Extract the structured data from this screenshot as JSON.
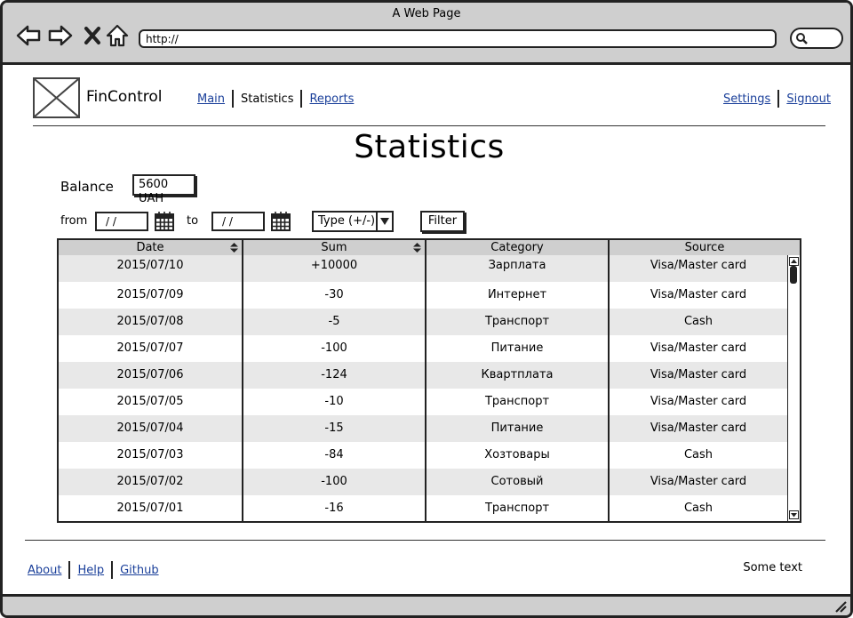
{
  "window": {
    "title": "A Web Page",
    "url": "http://"
  },
  "header": {
    "brand": "FinControl",
    "nav": [
      {
        "label": "Main",
        "link": true
      },
      {
        "label": "Statistics",
        "link": false
      },
      {
        "label": "Reports",
        "link": true
      }
    ],
    "right_nav": [
      {
        "label": "Settings"
      },
      {
        "label": "Signout"
      }
    ]
  },
  "page": {
    "title": "Statistics",
    "balance_label": "Balance",
    "balance_value": "5600 UAH",
    "from_label": "from",
    "to_label": "to",
    "from_value": "/ /",
    "to_value": "/ /",
    "type_select": "Type (+/-)",
    "filter_button": "Filter"
  },
  "table": {
    "columns": [
      "Date",
      "Sum",
      "Category",
      "Source"
    ],
    "rows": [
      [
        "2015/07/10",
        "+10000",
        "Зарплата",
        "Visa/Master card"
      ],
      [
        "2015/07/09",
        "-30",
        "Интернет",
        "Visa/Master card"
      ],
      [
        "2015/07/08",
        "-5",
        "Транспорт",
        "Cash"
      ],
      [
        "2015/07/07",
        "-100",
        "Питание",
        "Visa/Master card"
      ],
      [
        "2015/07/06",
        "-124",
        "Квартплата",
        "Visa/Master card"
      ],
      [
        "2015/07/05",
        "-10",
        "Транспорт",
        "Visa/Master card"
      ],
      [
        "2015/07/04",
        "-15",
        "Питание",
        "Visa/Master card"
      ],
      [
        "2015/07/03",
        "-84",
        "Хозтовары",
        "Cash"
      ],
      [
        "2015/07/02",
        "-100",
        "Сотовый",
        "Visa/Master card"
      ],
      [
        "2015/07/01",
        "-16",
        "Транспорт",
        "Cash"
      ]
    ]
  },
  "footer": {
    "links": [
      "About",
      "Help",
      "Github"
    ],
    "text": "Some text"
  },
  "icons": {
    "back": "arrow-left-icon",
    "forward": "arrow-right-icon",
    "stop": "close-icon",
    "home": "home-icon",
    "search": "search-icon",
    "calendar": "calendar-icon",
    "sort": "sort-icon",
    "dropdown": "chevron-down-icon",
    "resize": "resize-grip-icon",
    "logo": "image-placeholder-icon"
  },
  "colors": {
    "link": "#1a3f9a",
    "chrome": "#cfcfcf",
    "row_alt": "#e8e8e8"
  }
}
